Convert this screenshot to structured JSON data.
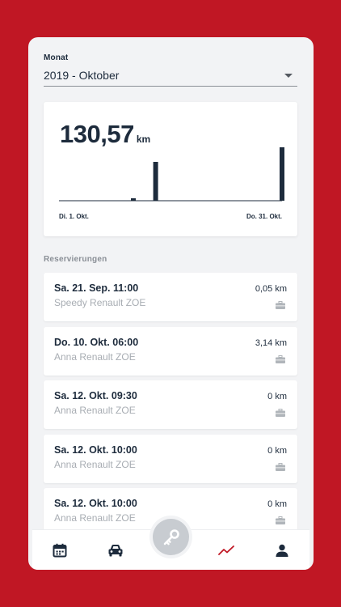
{
  "month": {
    "label": "Monat",
    "value": "2019 - Oktober"
  },
  "summary": {
    "total_value": "130,57",
    "total_unit": "km"
  },
  "chart_data": {
    "type": "bar",
    "x": [
      11,
      14,
      31
    ],
    "values": [
      2.5,
      40,
      55
    ],
    "xlim": [
      1,
      31
    ],
    "ylim": [
      0,
      60
    ],
    "xtick_labels": [
      "Di. 1. Okt.",
      "Do. 31. Okt."
    ],
    "grid": false
  },
  "reservations": {
    "title": "Reservierungen",
    "items": [
      {
        "title": "Sa. 21. Sep. 11:00",
        "vehicle": "Speedy Renault ZOE",
        "distance": "0,05 km",
        "icon": "briefcase-icon"
      },
      {
        "title": "Do. 10. Okt. 06:00",
        "vehicle": "Anna Renault ZOE",
        "distance": "3,14 km",
        "icon": "briefcase-icon"
      },
      {
        "title": "Sa. 12. Okt. 09:30",
        "vehicle": "Anna Renault ZOE",
        "distance": "0 km",
        "icon": "briefcase-icon"
      },
      {
        "title": "Sa. 12. Okt. 10:00",
        "vehicle": "Anna Renault ZOE",
        "distance": "0 km",
        "icon": "briefcase-icon"
      },
      {
        "title": "Sa. 12. Okt. 10:00",
        "vehicle": "Anna Renault ZOE",
        "distance": "0 km",
        "icon": "briefcase-icon"
      }
    ]
  },
  "nav": {
    "items": [
      "calendar-icon",
      "car-icon",
      "key-icon",
      "chart-line-icon",
      "person-icon"
    ],
    "active": "chart-line-icon",
    "active_color": "#c01724",
    "icon_color": "#1d2b3c"
  },
  "colors": {
    "brand": "#c01724",
    "text": "#1d2b3c",
    "muted": "#a8adb3"
  }
}
